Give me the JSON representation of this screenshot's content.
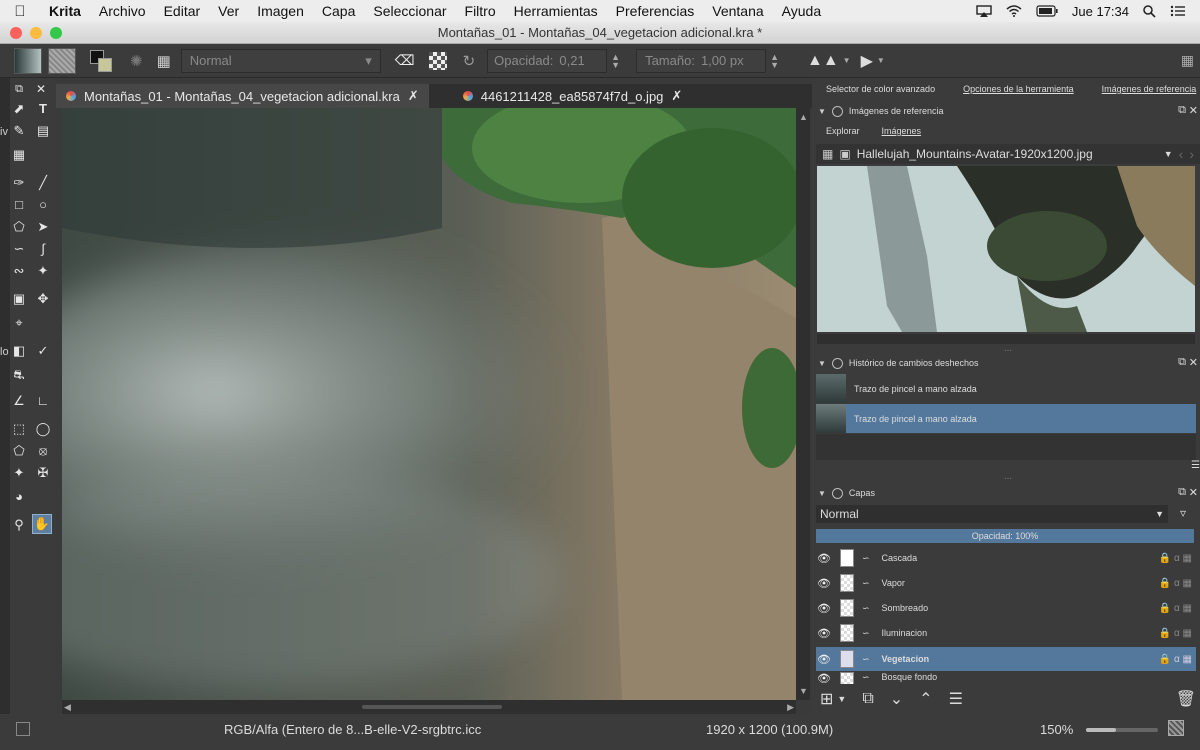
{
  "menubar": {
    "items": [
      "Krita",
      "Archivo",
      "Editar",
      "Ver",
      "Imagen",
      "Capa",
      "Seleccionar",
      "Filtro",
      "Herramientas",
      "Preferencias",
      "Ventana",
      "Ayuda"
    ],
    "clock": "Jue 17:34"
  },
  "window": {
    "title": "Montañas_01 - Montañas_04_vegetacion adicional.kra *"
  },
  "toolbar": {
    "blend_mode": "Normal",
    "opacity_label": "Opacidad:",
    "opacity_value": "0,21",
    "size_label": "Tamaño:",
    "size_value": "1,00 px"
  },
  "doc_tabs": [
    {
      "label": "Montañas_01 - Montañas_04_vegetacion adicional.kra",
      "active": true
    },
    {
      "label": "4461211428_ea85874f7d_o.jpg",
      "active": false
    }
  ],
  "left_edge": {
    "text_1": "iv",
    "text_2": "lo"
  },
  "dock": {
    "tabs": [
      "Selector de color avanzado",
      "Opciones de la herramienta",
      "Imágenes de referencia"
    ],
    "reference": {
      "title": "Imágenes de referencia",
      "subtabs": [
        "Explorar",
        "Imágenes"
      ],
      "file": "Hallelujah_Mountains-Avatar-1920x1200.jpg"
    },
    "history": {
      "title": "Histórico de cambios deshechos",
      "items": [
        "Trazo de pincel a mano alzada",
        "Trazo de pincel a mano alzada"
      ]
    },
    "layers": {
      "title": "Capas",
      "blend_mode": "Normal",
      "opacity_text": "Opacidad:  100%",
      "items": [
        "Cascada",
        "Vapor",
        "Sombreado",
        "Iluminacion",
        "Vegetacion",
        "Bosque fondo"
      ]
    }
  },
  "status": {
    "color_profile": "RGB/Alfa (Entero de 8...B-elle-V2-srgbtrc.icc",
    "dimensions": "1920 x 1200 (100.9M)",
    "zoom": "150%"
  },
  "colors": {
    "accent": "#54789c",
    "panel": "#3b3b3b",
    "dark": "#2f2f2f"
  }
}
